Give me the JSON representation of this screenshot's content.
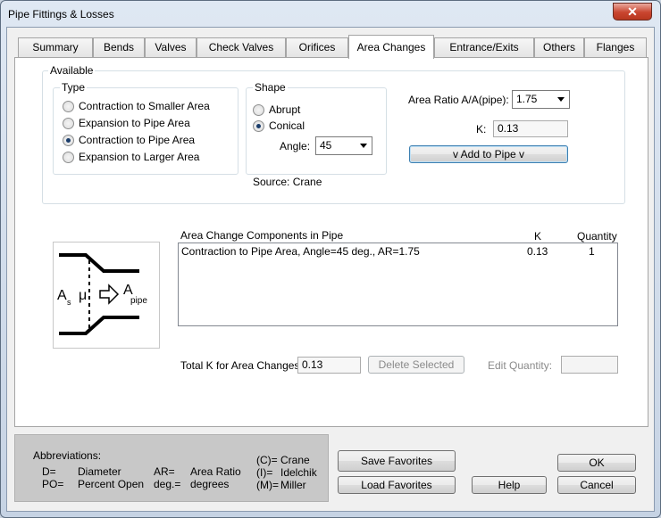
{
  "window": {
    "title": "Pipe Fittings & Losses",
    "close_glyph": "✕"
  },
  "tabs": [
    {
      "label": "Summary"
    },
    {
      "label": "Bends"
    },
    {
      "label": "Valves"
    },
    {
      "label": "Check Valves"
    },
    {
      "label": "Orifices"
    },
    {
      "label": "Area Changes"
    },
    {
      "label": "Entrance/Exits"
    },
    {
      "label": "Others"
    },
    {
      "label": "Flanges"
    }
  ],
  "active_tab": "Area Changes",
  "available": {
    "label": "Available",
    "type_group": {
      "label": "Type",
      "options": [
        {
          "label": "Contraction to Smaller Area",
          "selected": false
        },
        {
          "label": "Expansion to Pipe Area",
          "selected": false
        },
        {
          "label": "Contraction to Pipe Area",
          "selected": true
        },
        {
          "label": "Expansion to Larger Area",
          "selected": false
        }
      ]
    },
    "shape_group": {
      "label": "Shape",
      "options": [
        {
          "label": "Abrupt",
          "selected": false
        },
        {
          "label": "Conical",
          "selected": true
        }
      ],
      "angle_label": "Angle:",
      "angle_value": "45"
    },
    "area_ratio_label": "Area Ratio  A/A(pipe):",
    "area_ratio_value": "1.75",
    "k_label": "K:",
    "k_value": "0.13",
    "add_button": "v  Add to Pipe  v",
    "source": "Source: Crane"
  },
  "components": {
    "title": "Area Change Components in Pipe",
    "k_header": "K",
    "qty_header": "Quantity",
    "rows": [
      {
        "description": "Contraction to Pipe Area, Angle=45 deg., AR=1.75",
        "k": "0.13",
        "quantity": "1"
      }
    ],
    "total_label": "Total K for Area Changes:",
    "total_value": "0.13",
    "delete_button": "Delete Selected",
    "edit_qty_label": "Edit Quantity:",
    "edit_qty_value": ""
  },
  "diagram": {
    "label_as": "A",
    "label_as_sub": "s",
    "label_mu": "μ",
    "label_apipe": "A",
    "label_apipe_sub": "pipe"
  },
  "abbreviations": {
    "title": "Abbreviations:",
    "items": [
      {
        "key": "D=",
        "value": "Diameter"
      },
      {
        "key": "PO=",
        "value": "Percent Open"
      },
      {
        "key": "AR=",
        "value": "Area Ratio"
      },
      {
        "key": "deg.=",
        "value": "degrees"
      },
      {
        "key": "(C)=",
        "value": "Crane"
      },
      {
        "key": "(I)=",
        "value": "Idelchik"
      },
      {
        "key": "(M)=",
        "value": "Miller"
      }
    ]
  },
  "buttons": {
    "save_favorites": "Save Favorites",
    "load_favorites": "Load Favorites",
    "help": "Help",
    "ok": "OK",
    "cancel": "Cancel"
  }
}
